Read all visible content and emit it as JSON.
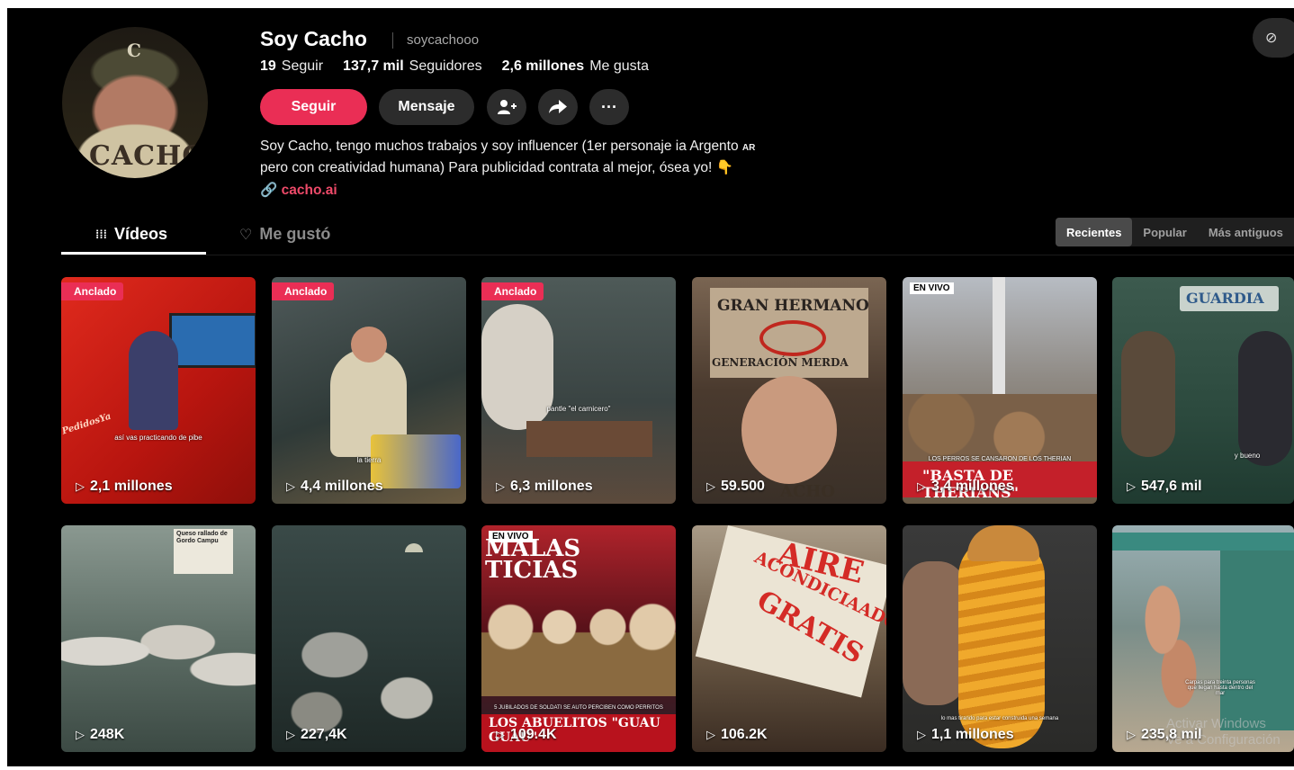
{
  "profile": {
    "name": "Soy Cacho",
    "handle": "soycachooo",
    "avatar_cap_letter": "C",
    "avatar_shirt_text": "CACHO",
    "stats": {
      "following_count": "19",
      "following_label": "Seguir",
      "followers_count": "137,7 mil",
      "followers_label": "Seguidores",
      "likes_count": "2,6 millones",
      "likes_label": "Me gusta"
    },
    "bio_line1": "Soy Cacho, tengo muchos trabajos y soy influencer (1er personaje ia Argento",
    "bio_flag": "AR",
    "bio_line2": "pero con creatividad humana) Para publicidad contrata al mejor, ósea yo! 👇",
    "link_text": "cacho.ai"
  },
  "buttons": {
    "follow": "Seguir",
    "message": "Mensaje",
    "add_friend_icon": "👤+",
    "share_icon": "➦",
    "more_icon": "···"
  },
  "tabs": {
    "videos_icon": "⁞⁞⁞",
    "videos": "Vídeos",
    "liked_icon": "♡",
    "liked": "Me gustó"
  },
  "sort": {
    "recent": "Recientes",
    "popular": "Popular",
    "oldest": "Más antiguos"
  },
  "badges": {
    "pinned": "Anclado",
    "live": "EN VIVO"
  },
  "videos": [
    {
      "views": "2,1 millones",
      "overlay": "así vas practicando de pibe",
      "logo": "PedidosYa"
    },
    {
      "views": "4,4 millones",
      "overlay": "la tierra"
    },
    {
      "views": "6,3 millones",
      "overlay": "pantle \"el carnicero\""
    },
    {
      "views": "59.500",
      "sign1": "GRAN HERMANO",
      "sign2": "GENERACIÓN MERDA",
      "shirt": "ACHO"
    },
    {
      "views": "3,4 millones",
      "headline": "\"BASTA DE THERIANS\"",
      "subhead": "LOS PERROS SE CANSARON DE LOS THERIAN"
    },
    {
      "views": "547,6 mil",
      "sign": "GUARDIA",
      "overlay": "y bueno"
    },
    {
      "views": "248K",
      "poster": "Queso rallado de Gordo Campu"
    },
    {
      "views": "227,4K"
    },
    {
      "views": "109.4K",
      "headline_top": "MALAS TICIAS",
      "caption": "LOS ABUELITOS \"GUAU GUAU\"",
      "subcaption": "5 JUBILADOS DE SOLDATI SE AUTO PERCIBEN COMO PERRITOS"
    },
    {
      "views": "106.2K",
      "sign1": "AIRE",
      "sign2": "ACONDICIAADO",
      "sign3": "GRATIS"
    },
    {
      "views": "1,1 millones",
      "overlay": "lo mas tirando para estar construida una semana"
    },
    {
      "views": "235,8 mil",
      "overlay": "Carpas para treinta personas que llegan hasta dentro del mar"
    }
  ],
  "watermark": {
    "line1": "Activar Windows",
    "line2": "Ve a Configuración"
  },
  "colors": {
    "accent": "#ea2e55",
    "background": "#000000"
  }
}
